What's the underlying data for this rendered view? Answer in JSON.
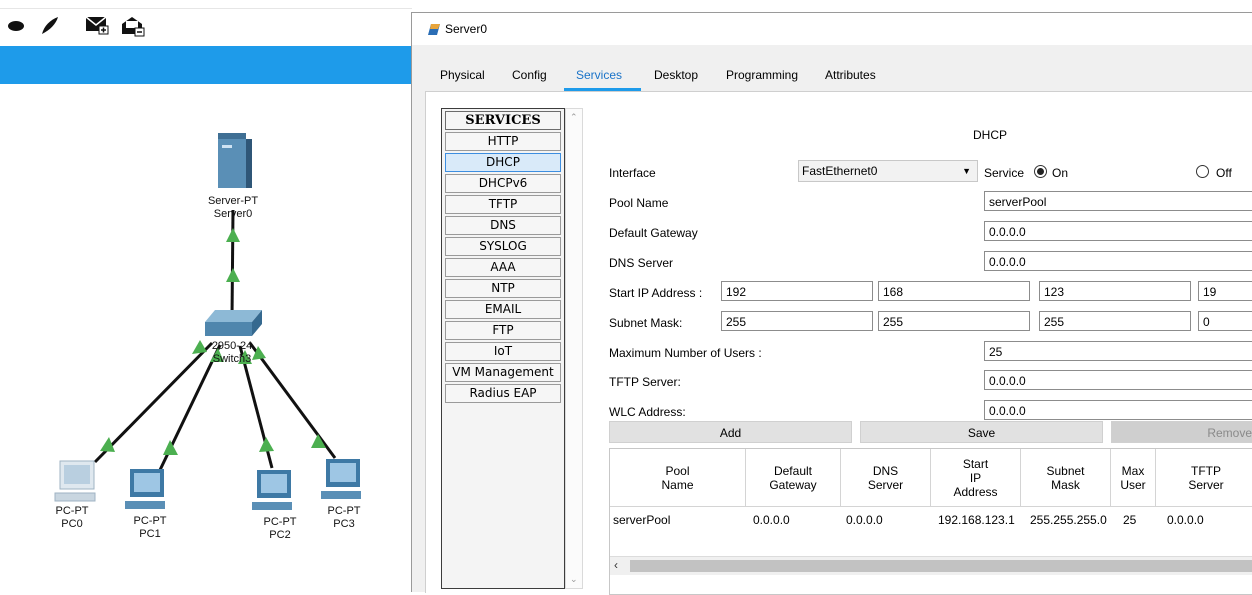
{
  "toolbar_icons": [
    "ellipse-icon",
    "pen-icon",
    "mail-icon",
    "open-mail-icon"
  ],
  "topology": {
    "server": {
      "label_type": "Server-PT",
      "label_name": "Server0"
    },
    "switch": {
      "label_type": "2950-24",
      "label_name": "Switch3"
    },
    "pcs": [
      {
        "label_type": "PC-PT",
        "label_name": "PC0"
      },
      {
        "label_type": "PC-PT",
        "label_name": "PC1"
      },
      {
        "label_type": "PC-PT",
        "label_name": "PC2"
      },
      {
        "label_type": "PC-PT",
        "label_name": "PC3"
      }
    ],
    "link_color": "#000000",
    "link_status_color": "#4caf50"
  },
  "window": {
    "title": "Server0",
    "tabs": [
      "Physical",
      "Config",
      "Services",
      "Desktop",
      "Programming",
      "Attributes"
    ],
    "active_tab": "Services"
  },
  "services": {
    "header": "SERVICES",
    "items": [
      "HTTP",
      "DHCP",
      "DHCPv6",
      "TFTP",
      "DNS",
      "SYSLOG",
      "AAA",
      "NTP",
      "EMAIL",
      "FTP",
      "IoT",
      "VM Management",
      "Radius EAP"
    ],
    "active": "DHCP"
  },
  "dhcp": {
    "title": "DHCP",
    "interface_label": "Interface",
    "interface_value": "FastEthernet0",
    "service_label": "Service",
    "on_label": "On",
    "off_label": "Off",
    "service_state": "On",
    "pool_name_label": "Pool Name",
    "pool_name": "serverPool",
    "default_gateway_label": "Default Gateway",
    "default_gateway": "0.0.0.0",
    "dns_server_label": "DNS Server",
    "dns_server": "0.0.0.0",
    "start_ip_label": "Start IP Address :",
    "start_ip": [
      "192",
      "168",
      "123",
      "19"
    ],
    "subnet_mask_label": "Subnet Mask:",
    "subnet_mask": [
      "255",
      "255",
      "255",
      "0"
    ],
    "max_users_label": "Maximum Number of Users :",
    "max_users": "25",
    "tftp_server_label": "TFTP Server:",
    "tftp_server": "0.0.0.0",
    "wlc_address_label": "WLC Address:",
    "wlc_address": "0.0.0.0",
    "add_label": "Add",
    "save_label": "Save",
    "remove_label": "Remove"
  },
  "pool_table": {
    "headers": [
      [
        "Pool",
        "Name"
      ],
      [
        "Default",
        "Gateway"
      ],
      [
        "DNS",
        "Server"
      ],
      [
        "Start",
        "IP",
        "Address"
      ],
      [
        "Subnet",
        "Mask"
      ],
      [
        "Max",
        "User"
      ],
      [
        "TFTP",
        "Server"
      ]
    ],
    "rows": [
      [
        "serverPool",
        "0.0.0.0",
        "0.0.0.0",
        "192.168.123.1",
        "255.255.255.0",
        "25",
        "0.0.0.0"
      ]
    ]
  }
}
